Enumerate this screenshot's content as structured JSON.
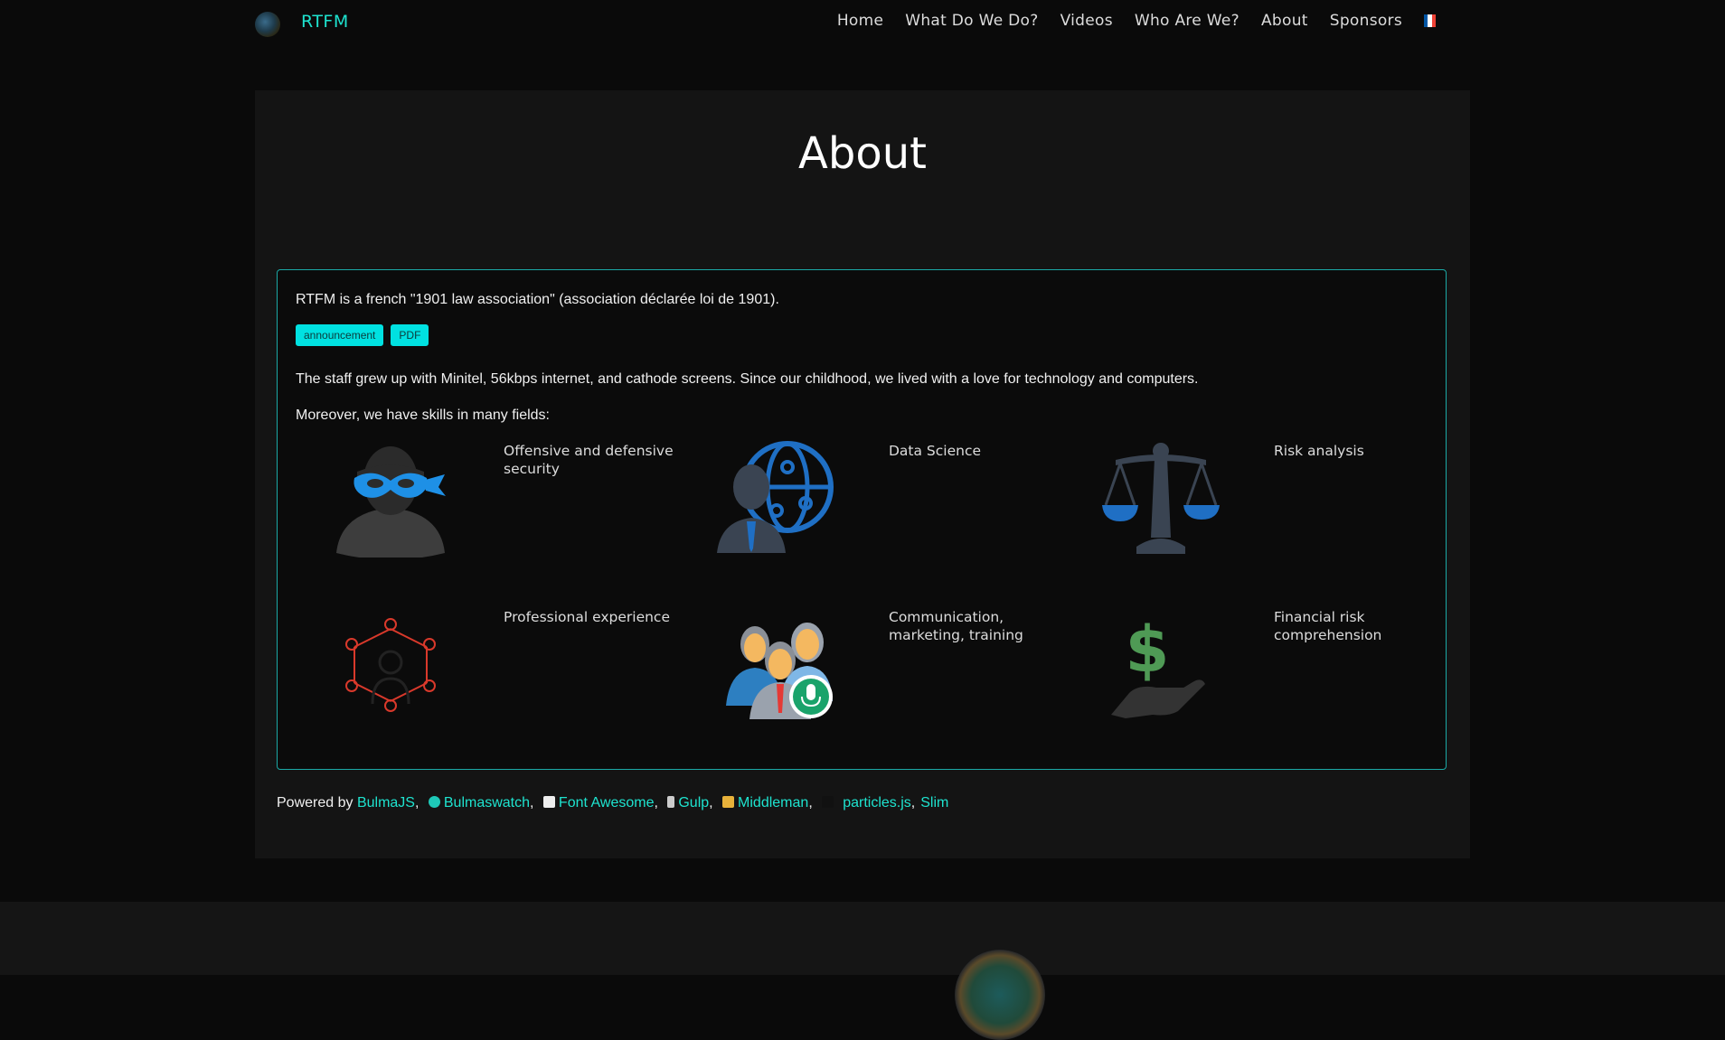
{
  "navbar": {
    "brand": "RTFM",
    "items": [
      "Home",
      "What Do We Do?",
      "Videos",
      "Who Are We?",
      "About",
      "Sponsors"
    ],
    "flag_colors": [
      "#0055a4",
      "#ffffff",
      "#ef4135"
    ]
  },
  "page": {
    "title": "About"
  },
  "card": {
    "intro": "RTFM is a french \"1901 law association\" (association déclarée loi de 1901).",
    "tags": [
      "announcement",
      "PDF"
    ],
    "staff": "The staff grew up with Minitel, 56kbps internet, and cathode screens. Since our childhood, we lived with a love for technology and computers.",
    "skills_intro": "Moreover, we have skills in many fields:",
    "skills": [
      {
        "label": "Offensive and defensive security",
        "icon": "masked-hacker-icon"
      },
      {
        "label": "Data Science",
        "icon": "data-science-icon"
      },
      {
        "label": "Risk analysis",
        "icon": "scales-icon"
      },
      {
        "label": "Professional experience",
        "icon": "network-person-icon"
      },
      {
        "label": "Communication, marketing, training",
        "icon": "team-microphone-icon"
      },
      {
        "label": "Financial risk comprehension",
        "icon": "money-hand-icon"
      }
    ]
  },
  "powered": {
    "prefix": "Powered by",
    "links": [
      "BulmaJS",
      "Bulmaswatch",
      "Font Awesome",
      "Gulp",
      "Middleman",
      "particles.js",
      "Slim"
    ]
  },
  "colors": {
    "accent": "#1ee3cf",
    "tag": "#00e1e1",
    "card_border": "#1ba9a6"
  }
}
